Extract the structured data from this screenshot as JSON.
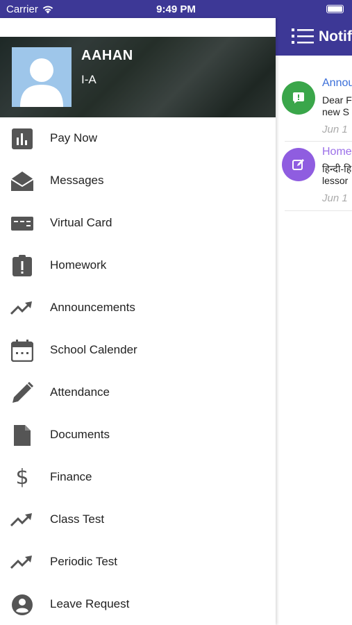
{
  "status_bar": {
    "carrier": "Carrier",
    "time": "9:49 PM"
  },
  "background_screen": {
    "title": "Notif",
    "notifications": [
      {
        "title": "Annou",
        "body_line1": "Dear F",
        "body_line2": "new S",
        "date": "Jun 1",
        "title_color": "#3b6fd9",
        "icon_color": "#3aa64a",
        "icon": "alert-message-icon"
      },
      {
        "title": "Home",
        "body_line1": "हिन्दी-हि",
        "body_line2": "lessor",
        "date": "Jun 1",
        "title_color": "#9b6fe8",
        "icon_color": "#8f5de0",
        "icon": "edit-icon"
      }
    ]
  },
  "profile": {
    "name": "AAHAN",
    "class": "I-A"
  },
  "menu": {
    "items": [
      {
        "label": "Pay Now",
        "icon": "bar-chart-icon"
      },
      {
        "label": "Messages",
        "icon": "envelope-open-icon"
      },
      {
        "label": "Virtual Card",
        "icon": "card-icon"
      },
      {
        "label": "Homework",
        "icon": "clipboard-alert-icon"
      },
      {
        "label": "Announcements",
        "icon": "trending-up-icon"
      },
      {
        "label": "School Calender",
        "icon": "calendar-icon"
      },
      {
        "label": "Attendance",
        "icon": "pencil-icon"
      },
      {
        "label": "Documents",
        "icon": "document-icon"
      },
      {
        "label": "Finance",
        "icon": "dollar-icon"
      },
      {
        "label": "Class Test",
        "icon": "trending-up-icon"
      },
      {
        "label": "Periodic Test",
        "icon": "trending-up-icon"
      },
      {
        "label": "Leave Request",
        "icon": "account-circle-icon"
      }
    ]
  },
  "colors": {
    "primary": "#3d3896",
    "icon_gray": "#555555"
  }
}
